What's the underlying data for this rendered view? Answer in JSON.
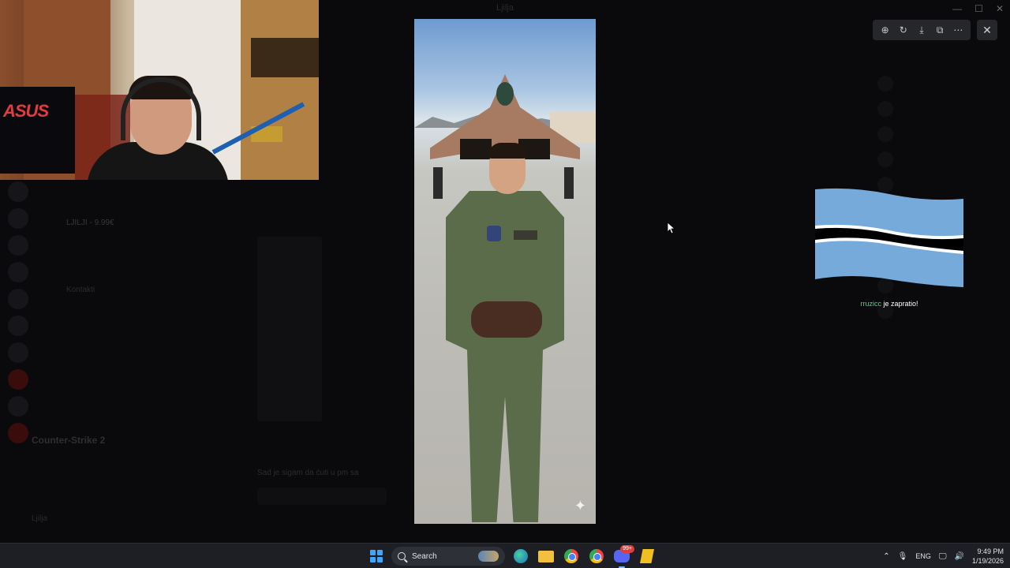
{
  "window": {
    "title": "Ljilja",
    "controls": [
      "minimize",
      "maximize",
      "close"
    ]
  },
  "background": {
    "channels": [
      "",
      "",
      "LJILJI - 9.99€",
      "",
      "",
      "Kontakti",
      "",
      "",
      "",
      "",
      "",
      ""
    ],
    "game_banner": "Counter-Strike 2",
    "chat_message": "Sad je sigam da ćuti u pm sa",
    "user": "Ljilja"
  },
  "viewer": {
    "toolbar": [
      {
        "name": "zoom-in-icon",
        "glyph": "⊕"
      },
      {
        "name": "rotate-icon",
        "glyph": "↻"
      },
      {
        "name": "download-icon",
        "glyph": "⤓"
      },
      {
        "name": "open-external-icon",
        "glyph": "⧉"
      },
      {
        "name": "more-options-icon",
        "glyph": "⋯"
      }
    ],
    "close_glyph": "✕",
    "sparkle_glyph": "✦"
  },
  "alert": {
    "user": "rruzicc",
    "message": " je zapratio!",
    "flag_colors": {
      "light_blue": "#75AADB",
      "white": "#FFFFFF",
      "black": "#000000"
    }
  },
  "taskbar": {
    "search_label": "Search",
    "discord_badge": "99+",
    "language": "ENG",
    "time": "9:49 PM",
    "date": "1/19/2026",
    "tray_icons": [
      "chevron-up-icon",
      "microphone-icon"
    ],
    "status_icons": [
      "monitor-icon",
      "volume-icon"
    ]
  },
  "colors": {
    "accent": "#3FA6FF",
    "discord": "#5865F2",
    "alert_user": "#4FD38A"
  }
}
